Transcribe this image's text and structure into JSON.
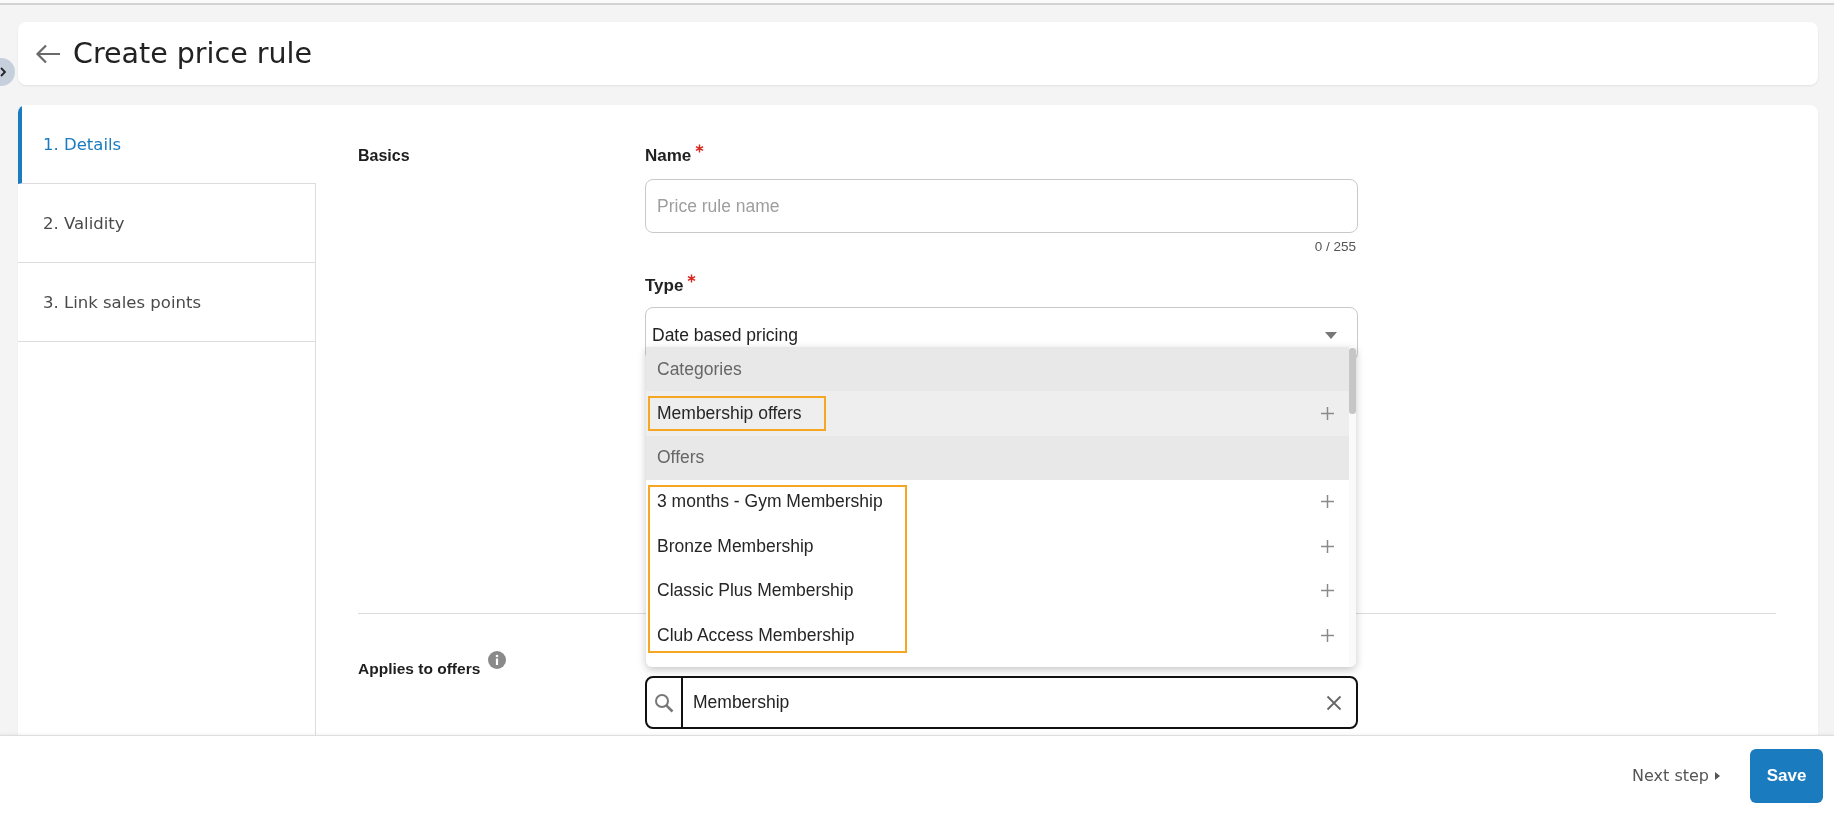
{
  "header": {
    "title": "Create price rule"
  },
  "steps": [
    {
      "label": "1. Details",
      "selected": true
    },
    {
      "label": "2. Validity",
      "selected": false
    },
    {
      "label": "3. Link sales points",
      "selected": false
    }
  ],
  "basics": {
    "heading": "Basics",
    "name_field": {
      "label": "Name",
      "required": true,
      "placeholder": "Price rule name",
      "counter": "0 / 255"
    },
    "type_field": {
      "label": "Type",
      "required": true,
      "value": "Date based pricing",
      "expanded": true
    }
  },
  "dropdown": {
    "groups": [
      {
        "header": "Categories",
        "highlighted": true,
        "items": [
          {
            "label": "Membership offers",
            "hovered": true
          }
        ]
      },
      {
        "header": "Offers",
        "highlighted": true,
        "items": [
          {
            "label": "3 months - Gym Membership",
            "hovered": false
          },
          {
            "label": "Bronze Membership",
            "hovered": false
          },
          {
            "label": "Classic Plus Membership",
            "hovered": false
          },
          {
            "label": "Club Access Membership",
            "hovered": false
          }
        ]
      }
    ]
  },
  "applies_to_offers": {
    "label": "Applies to offers",
    "search": {
      "value": "Membership"
    }
  },
  "footer": {
    "next_step": "Next step",
    "save": "Save"
  }
}
